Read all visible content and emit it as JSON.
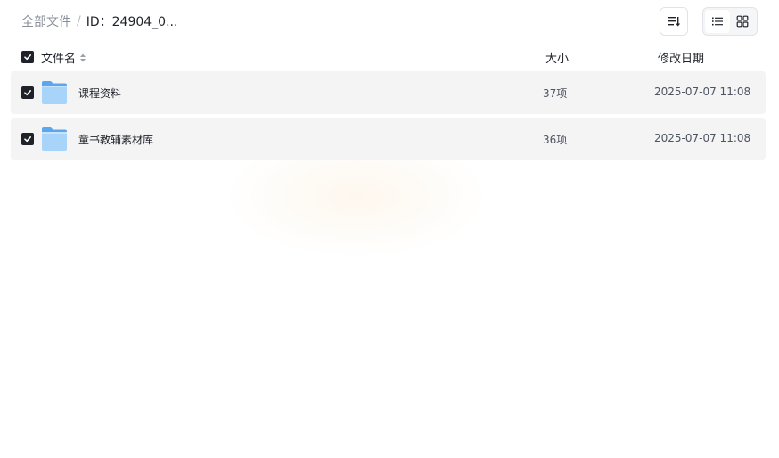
{
  "breadcrumb": {
    "root": "全部文件",
    "separator": "/",
    "current": "ID：24904_0..."
  },
  "toolbar": {
    "sort_icon": "sort-icon",
    "view_list_icon": "list-view-icon",
    "view_grid_icon": "grid-view-icon",
    "active_view": "list"
  },
  "table": {
    "headers": {
      "name": "文件名",
      "size": "大小",
      "date": "修改日期"
    },
    "select_all_checked": true,
    "rows": [
      {
        "name": "课程资料",
        "size": "37项",
        "date": "2025-07-07 11:08",
        "checked": true,
        "icon": "folder-icon"
      },
      {
        "name": "童书教辅素材库",
        "size": "36项",
        "date": "2025-07-07 11:08",
        "checked": true,
        "icon": "folder-icon"
      }
    ]
  },
  "colors": {
    "checkbox": "#1f2329",
    "row_bg": "#f4f4f5",
    "folder_light": "#a9d4fa",
    "folder_dark": "#5aa7f0"
  }
}
